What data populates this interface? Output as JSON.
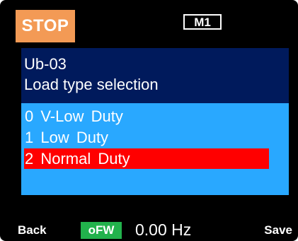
{
  "status": {
    "run_state": "STOP",
    "mode": "M1"
  },
  "parameter": {
    "code": "Ub-03",
    "title": "Load type selection"
  },
  "options": [
    {
      "label": "0  V-Low  Duty",
      "selected": false
    },
    {
      "label": "1  Low  Duty",
      "selected": false
    },
    {
      "label": "2  Normal  Duty",
      "selected": true
    }
  ],
  "footer": {
    "back_label": "Back",
    "direction": "oFW",
    "frequency": "0.00 Hz",
    "save_label": "Save"
  },
  "colors": {
    "stop_badge": "#f39a55",
    "header_bg": "#001a5c",
    "panel_bg": "#29a8ff",
    "selected_bg": "#ff0000",
    "direction_badge": "#22b24c",
    "screen_bg": "#000000"
  }
}
